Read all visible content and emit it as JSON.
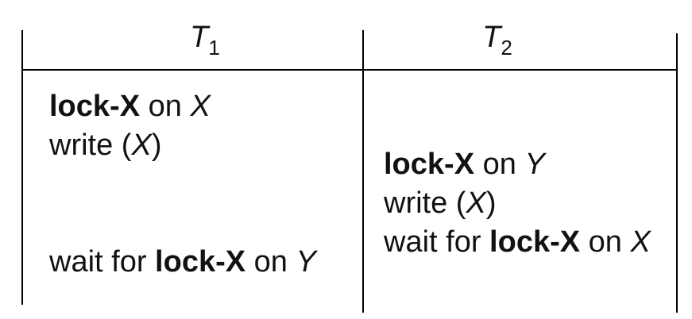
{
  "header": {
    "t1": {
      "base": "T",
      "sub": "1"
    },
    "t2": {
      "base": "T",
      "sub": "2"
    }
  },
  "t1_ops": {
    "lock_x_x": {
      "keyword": "lock-X",
      "on": " on ",
      "var": "X"
    },
    "write_x": {
      "pre": "write (",
      "var": "X",
      "post": ")"
    },
    "wait_lock_y": {
      "pre": "wait for ",
      "keyword": "lock-X",
      "on": " on ",
      "var": "Y"
    }
  },
  "t2_ops": {
    "lock_x_y": {
      "keyword": "lock-X",
      "on": " on ",
      "var": "Y"
    },
    "write_x": {
      "pre": "write (",
      "var": "X",
      "post": ")"
    },
    "wait_lock_x": {
      "pre": "wait for ",
      "keyword": "lock-X",
      "on": " on ",
      "var": "X"
    }
  }
}
